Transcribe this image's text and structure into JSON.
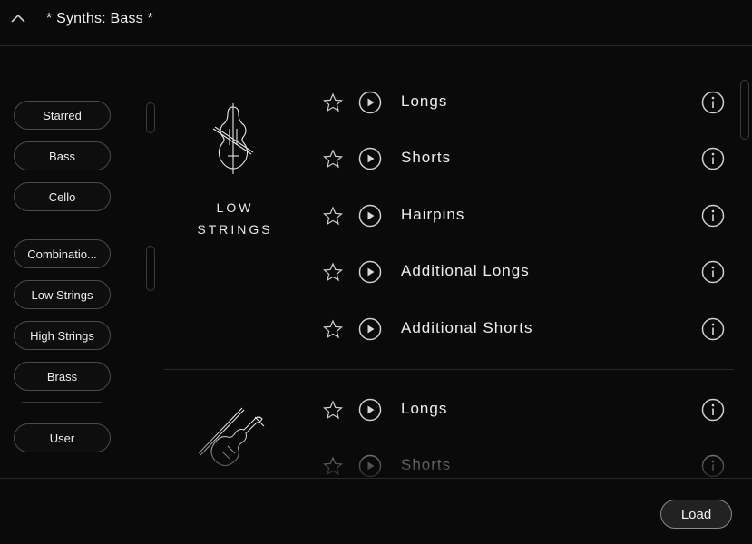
{
  "header": {
    "title": "* Synths: Bass *",
    "collapse_icon": "chevron-up-icon"
  },
  "sidebar": {
    "filters": [
      {
        "label": "Starred"
      },
      {
        "label": "Bass"
      },
      {
        "label": "Cello"
      }
    ],
    "categories": [
      {
        "label": "Combinatio..."
      },
      {
        "label": "Low Strings"
      },
      {
        "label": "High Strings"
      },
      {
        "label": "Brass"
      }
    ],
    "user": {
      "label": "User"
    }
  },
  "groups": [
    {
      "name_line1": "LOW",
      "name_line2": "STRINGS",
      "icon": "cello-icon",
      "items": [
        {
          "label": "Longs"
        },
        {
          "label": "Shorts"
        },
        {
          "label": "Hairpins"
        },
        {
          "label": "Additional Longs"
        },
        {
          "label": "Additional Shorts"
        }
      ]
    },
    {
      "icon": "violin-icon",
      "items": [
        {
          "label": "Longs"
        },
        {
          "label": "Shorts"
        }
      ]
    }
  ],
  "footer": {
    "load_label": "Load"
  },
  "colors": {
    "background": "#0a0a0a",
    "text": "#e6e6e6",
    "divider": "#2a2a2a"
  }
}
